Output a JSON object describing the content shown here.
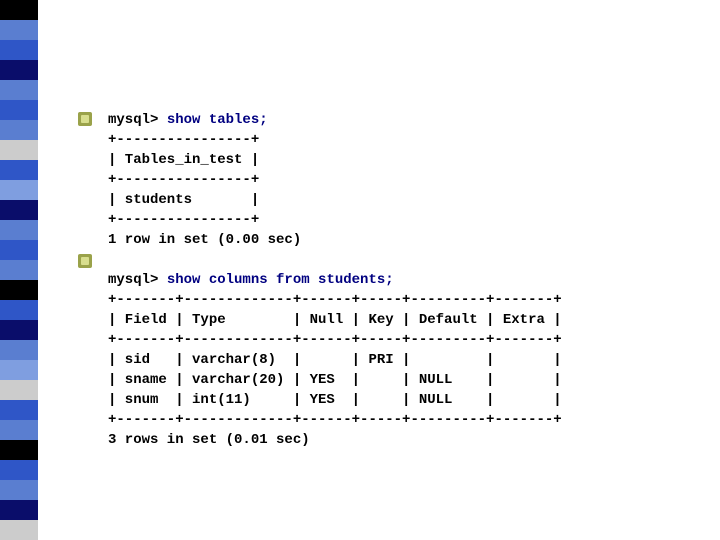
{
  "stripe_colors": [
    "#000000",
    "#5a7ed0",
    "#2f56c7",
    "#0a0d6a",
    "#5a7ed0",
    "#2f56c7",
    "#5a7ed0",
    "#cccccc",
    "#2f56c7",
    "#7f9ee0",
    "#0a0d6a",
    "#5a7ed0",
    "#2f56c7",
    "#5a7ed0",
    "#000000",
    "#2f56c7",
    "#0a0d6a",
    "#5a7ed0",
    "#7f9ee0",
    "#cccccc",
    "#2f56c7",
    "#5a7ed0",
    "#000000",
    "#2f56c7",
    "#5a7ed0",
    "#0a0d6a",
    "#cccccc"
  ],
  "block1": {
    "prompt": "mysql> ",
    "command": "show tables;",
    "borderTop": "+----------------+",
    "header": "| Tables_in_test |",
    "borderMid": "+----------------+",
    "row": "| students       |",
    "borderBot": "+----------------+",
    "footer": "1 row in set (0.00 sec)"
  },
  "block2": {
    "prompt": "mysql> ",
    "command": "show columns from students;",
    "borderTop": "+-------+-------------+------+-----+---------+-------+",
    "header": "| Field | Type        | Null | Key | Default | Extra |",
    "borderMid": "+-------+-------------+------+-----+---------+-------+",
    "row1": "| sid   | varchar(8)  |      | PRI |         |       |",
    "row2": "| sname | varchar(20) | YES  |     | NULL    |       |",
    "row3": "| snum  | int(11)     | YES  |     | NULL    |       |",
    "borderBot": "+-------+-------------+------+-----+---------+-------+",
    "footer": "3 rows in set (0.01 sec)"
  },
  "chart_data": [
    {
      "type": "table",
      "title": "Tables_in_test",
      "categories": [
        "Tables_in_test"
      ],
      "rows": [
        [
          "students"
        ]
      ],
      "footer": "1 row in set (0.00 sec)"
    },
    {
      "type": "table",
      "title": "Columns from students",
      "categories": [
        "Field",
        "Type",
        "Null",
        "Key",
        "Default",
        "Extra"
      ],
      "rows": [
        [
          "sid",
          "varchar(8)",
          "",
          "PRI",
          "",
          ""
        ],
        [
          "sname",
          "varchar(20)",
          "YES",
          "",
          "NULL",
          ""
        ],
        [
          "snum",
          "int(11)",
          "YES",
          "",
          "NULL",
          ""
        ]
      ],
      "footer": "3 rows in set (0.01 sec)"
    }
  ]
}
